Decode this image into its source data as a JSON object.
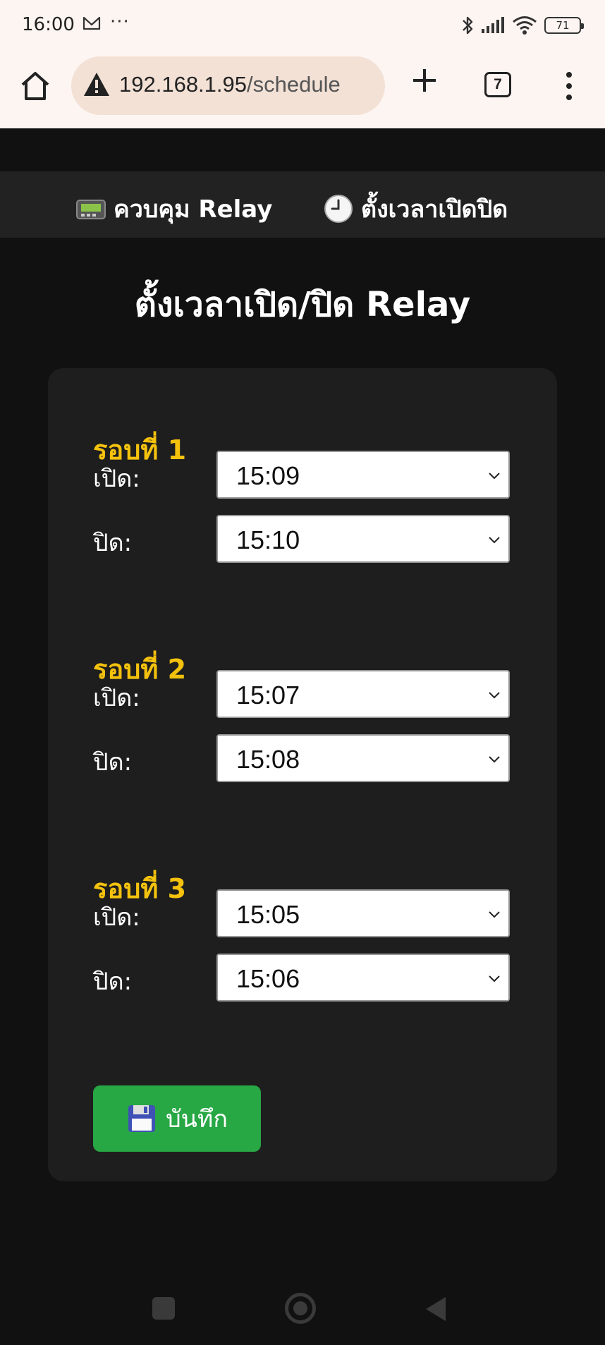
{
  "status_bar": {
    "time": "16:00",
    "more": "···",
    "battery": "71",
    "icons": [
      "mail-icon",
      "bluetooth-icon",
      "signal-icon",
      "wifi-icon",
      "battery-icon"
    ]
  },
  "browser": {
    "url_host": "192.168.1.95",
    "url_path": "/schedule",
    "tab_count": "7"
  },
  "nav": {
    "relay_label": "ควบคุม Relay",
    "schedule_label": "ตั้งเวลาเปิดปิด"
  },
  "page": {
    "title": "ตั้งเวลาเปิด/ปิด Relay"
  },
  "rounds": [
    {
      "title": "รอบที่ 1",
      "on_label": "เปิด:",
      "on_time": "15:09",
      "off_label": "ปิด:",
      "off_time": "15:10"
    },
    {
      "title": "รอบที่ 2",
      "on_label": "เปิด:",
      "on_time": "15:07",
      "off_label": "ปิด:",
      "off_time": "15:08"
    },
    {
      "title": "รอบที่ 3",
      "on_label": "เปิด:",
      "on_time": "15:05",
      "off_label": "ปิด:",
      "off_time": "15:06"
    }
  ],
  "save_button": {
    "label": "บันทึก"
  },
  "colors": {
    "background": "#111111",
    "nav_bg": "#222222",
    "card_bg": "#1e1e1e",
    "accent_yellow": "#f4c20d",
    "save_green": "#28a745"
  }
}
